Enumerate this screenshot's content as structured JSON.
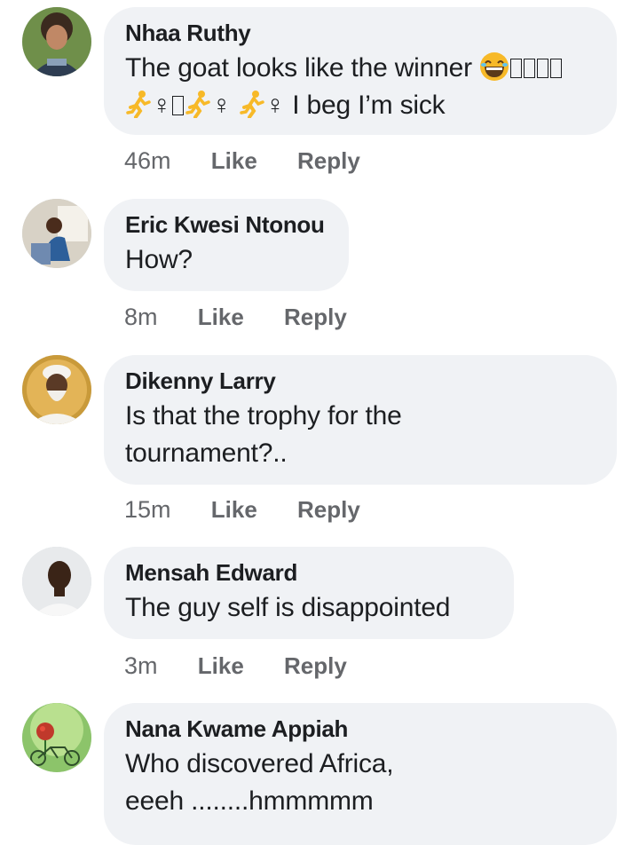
{
  "comments": [
    {
      "author": "Nhaa Ruthy",
      "text_line1": "The goat looks like the winner",
      "text_line2_end": "I beg I’m sick",
      "female_sign": "♀",
      "time": "46m",
      "like": "Like",
      "reply": "Reply",
      "icons": [
        "laughing-emoji",
        "running-woman-emoji"
      ]
    },
    {
      "author": "Eric Kwesi Ntonou",
      "text": "How?",
      "time": "8m",
      "like": "Like",
      "reply": "Reply"
    },
    {
      "author": "Dikenny Larry",
      "text_line1": "Is that the trophy for the",
      "text_line2": "tournament?..",
      "time": "15m",
      "like": "Like",
      "reply": "Reply"
    },
    {
      "author": "Mensah Edward",
      "text": "The guy self is disappointed",
      "time": "3m",
      "like": "Like",
      "reply": "Reply"
    },
    {
      "author": "Nana Kwame Appiah",
      "text_line1": "Who discovered Africa,",
      "text_line2": "eeeh ........hmmmmm"
    }
  ],
  "colors": {
    "bubble_bg": "#f0f2f5",
    "meta_text": "#65676b",
    "primary_text": "#1c1e21",
    "emoji_yellow": "#f7b928"
  }
}
